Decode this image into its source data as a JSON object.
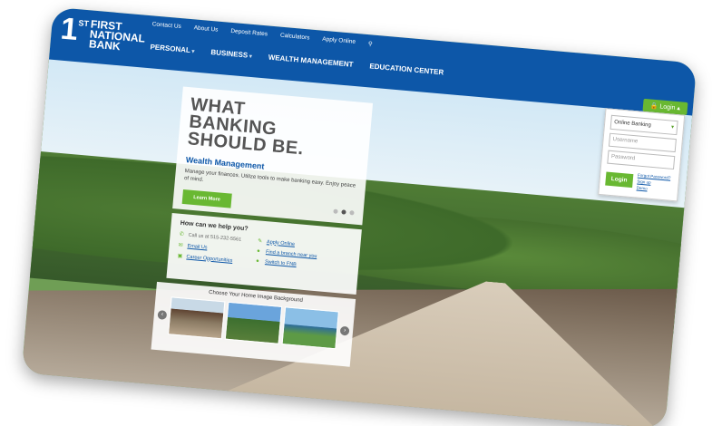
{
  "logo": {
    "num": "1",
    "sup": "ST",
    "lines": [
      "FIRST",
      "NATIONAL",
      "BANK"
    ]
  },
  "util_nav": [
    "Contact Us",
    "About Us",
    "Deposit Rates",
    "Calculators",
    "Apply Online"
  ],
  "main_nav": [
    "PERSONAL",
    "BUSINESS",
    "WEALTH MANAGEMENT",
    "EDUCATION CENTER"
  ],
  "login": {
    "toggle": "Login",
    "select": "Online Banking",
    "username_placeholder": "Username",
    "password_placeholder": "Password",
    "submit": "Login",
    "links": [
      "Forgot Password?",
      "Sign up",
      "Demo"
    ]
  },
  "hero": {
    "title": "WHAT BANKING SHOULD BE.",
    "subtitle": "Wealth Management",
    "description": "Manage your finances. Utilize tools to make banking easy. Enjoy peace of mind.",
    "button": "Learn More"
  },
  "help": {
    "title": "How can we help you?",
    "left": [
      "Call us at 515-232-5561",
      "Email Us",
      "Career Opportunities"
    ],
    "right": [
      "Apply Online",
      "Find a branch near you",
      "Switch to FNB"
    ]
  },
  "background_picker": {
    "title": "Choose Your Home Image Background"
  }
}
